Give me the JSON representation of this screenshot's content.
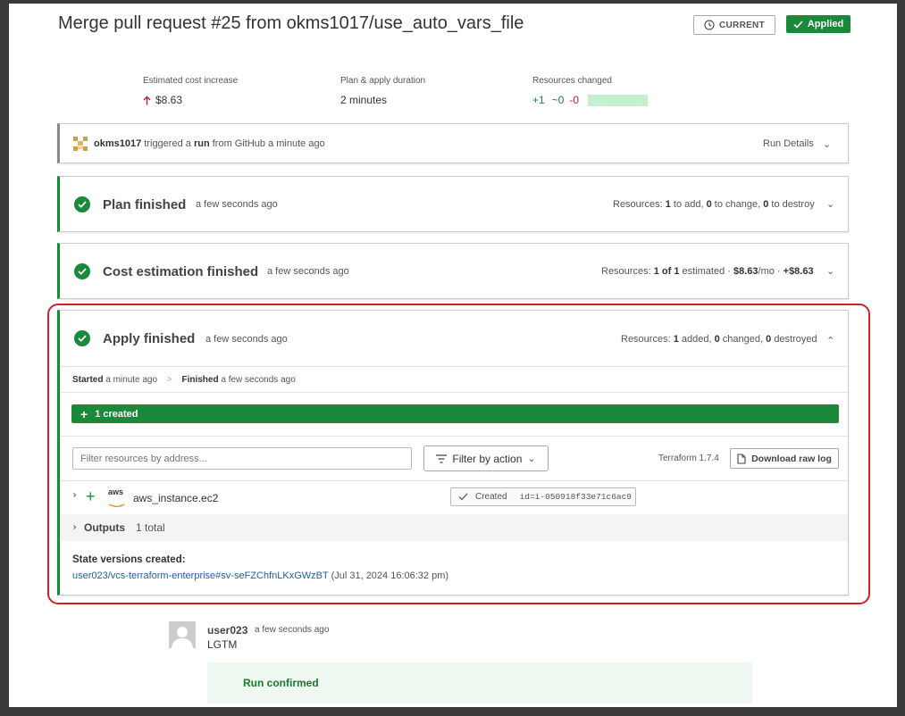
{
  "header": {
    "title": "Merge pull request #25 from okms1017/use_auto_vars_file",
    "current_label": "CURRENT",
    "applied_label": "Applied"
  },
  "stats": {
    "cost_label": "Estimated cost increase",
    "cost_value": "$8.63",
    "duration_label": "Plan & apply duration",
    "duration_value": "2 minutes",
    "resources_label": "Resources changed",
    "added": "+1",
    "changed": "~0",
    "destroyed": "-0"
  },
  "trigger": {
    "user": "okms1017",
    "t1": "triggered a",
    "run": "run",
    "t2": "from GitHub a minute ago",
    "details": "Run Details"
  },
  "plan": {
    "title": "Plan finished",
    "time": "a few seconds ago",
    "r_label": "Resources:",
    "add": "1",
    "add_t": "to add,",
    "change": "0",
    "change_t": "to change,",
    "destroy": "0",
    "destroy_t": "to destroy"
  },
  "cost": {
    "title": "Cost estimation finished",
    "time": "a few seconds ago",
    "r_label": "Resources:",
    "of": "1 of 1",
    "estimated": "estimated ·",
    "monthly": "$8.63",
    "per_mo": "/mo ·",
    "delta": "+$8.63"
  },
  "apply": {
    "title": "Apply finished",
    "time": "a few seconds ago",
    "r_label": "Resources:",
    "added": "1",
    "added_t": "added,",
    "changed": "0",
    "changed_t": "changed,",
    "destroyed": "0",
    "destroyed_t": "destroyed",
    "started_label": "Started",
    "started_time": "a minute ago",
    "arrow": ">",
    "finished_label": "Finished",
    "finished_time": "a few seconds ago",
    "created_bar": "1 created",
    "filter_placeholder": "Filter resources by address...",
    "filter_action": "Filter by action",
    "terraform_version": "Terraform 1.7.4",
    "download": "Download raw log",
    "resource_name": "aws_instance.ec2",
    "aws_text": "aws",
    "created_label": "Created",
    "resource_id": "id=i-050918f33e71c6ac9",
    "outputs_label": "Outputs",
    "outputs_count": "1 total",
    "state_label": "State versions created:",
    "state_link": "user023/vcs-terraform-enterprise#sv-seFZChfnLKxGWzBT",
    "state_time": "(Jul 31, 2024 16:06:32 pm)"
  },
  "comment": {
    "user": "user023",
    "time": "a few seconds ago",
    "text": "LGTM",
    "confirmed": "Run confirmed"
  },
  "colors": {
    "green": "#1a8a3a",
    "red": "#d0202a",
    "link": "#1f5fb0",
    "blue_changed": "#1f5fb0"
  },
  "resources_bar": {
    "added_fraction": 1.0
  }
}
